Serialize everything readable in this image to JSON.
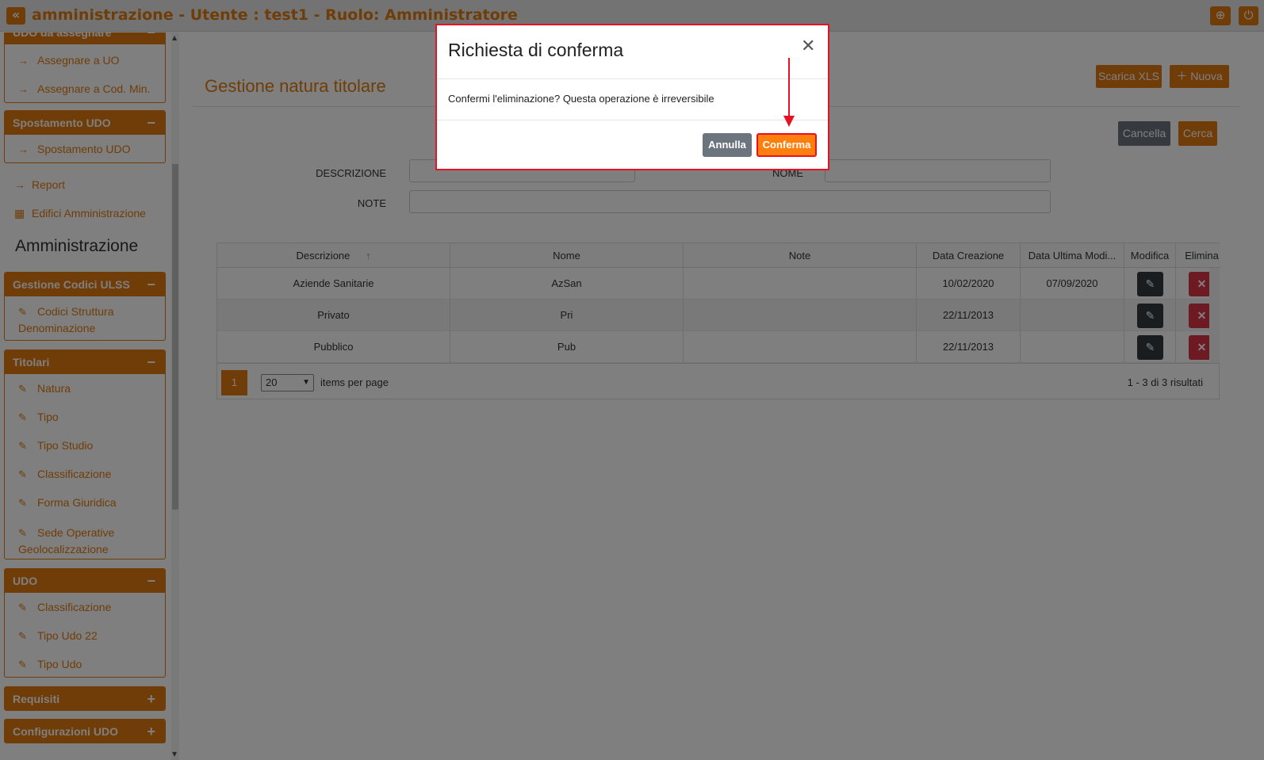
{
  "topbar": {
    "title": "amministrazione - Utente : test1 - Ruolo: Amministratore",
    "collapse_icon": "«",
    "globe_icon": "⊕",
    "power_icon": "⏻"
  },
  "sidebar": {
    "udo_da_assegnare": {
      "title": "UDO da assegnare",
      "items": [
        "Assegnare a UO",
        "Assegnare a Cod. Min."
      ]
    },
    "spostamento_udo": {
      "title": "Spostamento UDO",
      "items": [
        "Spostamento UDO"
      ]
    },
    "loose_items": [
      "Report",
      "Edifici Amministrazione"
    ],
    "section_title": "Amministrazione",
    "gestione_codici": {
      "title": "Gestione Codici ULSS",
      "items": [
        "Codici Struttura Denominazione"
      ]
    },
    "titolari": {
      "title": "Titolari",
      "items": [
        "Natura",
        "Tipo",
        "Tipo Studio",
        "Classificazione",
        "Forma Giuridica",
        "Sede Operative Geolocalizzazione"
      ]
    },
    "udo": {
      "title": "UDO",
      "items": [
        "Classificazione",
        "Tipo Udo 22",
        "Tipo Udo"
      ]
    },
    "requisiti": {
      "title": "Requisiti"
    },
    "configurazioni_udo": {
      "title": "Configurazioni UDO"
    }
  },
  "main": {
    "title": "Gestione natura titolare",
    "buttons": {
      "scarica_xls": "Scarica XLS",
      "nuova": "Nuova",
      "cancella": "Cancella",
      "cerca": "Cerca"
    },
    "filters": {
      "descrizione_label": "DESCRIZIONE",
      "nome_label": "NOME",
      "note_label": "NOTE"
    }
  },
  "grid": {
    "columns": [
      "Descrizione",
      "Nome",
      "Note",
      "Data Creazione",
      "Data Ultima Modi...",
      "Modifica",
      "Elimina"
    ],
    "sort_indicator": "↑",
    "rows": [
      {
        "descrizione": "Aziende Sanitarie",
        "nome": "AzSan",
        "note": "",
        "data_creazione": "10/02/2020",
        "data_ultima_modifica": "07/09/2020"
      },
      {
        "descrizione": "Privato",
        "nome": "Pri",
        "note": "",
        "data_creazione": "22/11/2013",
        "data_ultima_modifica": ""
      },
      {
        "descrizione": "Pubblico",
        "nome": "Pub",
        "note": "",
        "data_creazione": "22/11/2013",
        "data_ultima_modifica": ""
      }
    ],
    "pager": {
      "current_page": "1",
      "page_size": "20",
      "items_per_page_label": "items per page",
      "info": "1 - 3 di 3 risultati"
    }
  },
  "modal": {
    "title": "Richiesta di conferma",
    "close_icon": "✕",
    "message": "Confermi l'eliminazione? Questa operazione è irreversibile",
    "cancel_label": "Annulla",
    "confirm_label": "Conferma"
  }
}
